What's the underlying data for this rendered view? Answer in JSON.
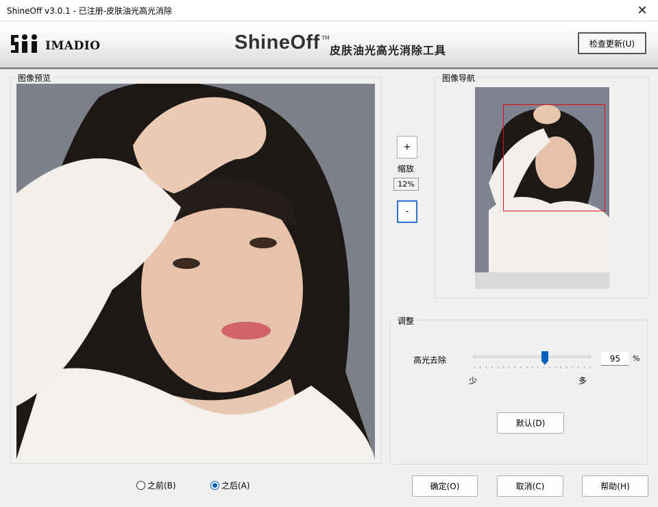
{
  "window": {
    "title": "ShineOff v3.0.1 - 已注册-皮肤油光高光消除"
  },
  "banner": {
    "company": "IMADIO",
    "app_name": "ShineOff",
    "tm": "TM",
    "app_subtitle": "皮肤油光高光消除工具",
    "update_button": "检查更新(U)"
  },
  "preview": {
    "label": "图像预览"
  },
  "navigator": {
    "label": "图像导航"
  },
  "zoom": {
    "in_label": "+",
    "label": "缩放",
    "value": "12%",
    "out_label": "-"
  },
  "adjust": {
    "label": "调整",
    "slider_label": "高光去除",
    "slider_value": "95",
    "slider_level": 0.61,
    "unit": "%",
    "min_label": "少",
    "max_label": "多",
    "default_button": "默认(D)"
  },
  "view": {
    "before_label": "之前(B)",
    "after_label": "之后(A)",
    "selected": "after"
  },
  "buttons": {
    "ok": "确定(O)",
    "cancel": "取消(C)",
    "help": "帮助(H)"
  },
  "colors": {
    "accent": "#0060c0",
    "nav_rect": "#e01010"
  }
}
